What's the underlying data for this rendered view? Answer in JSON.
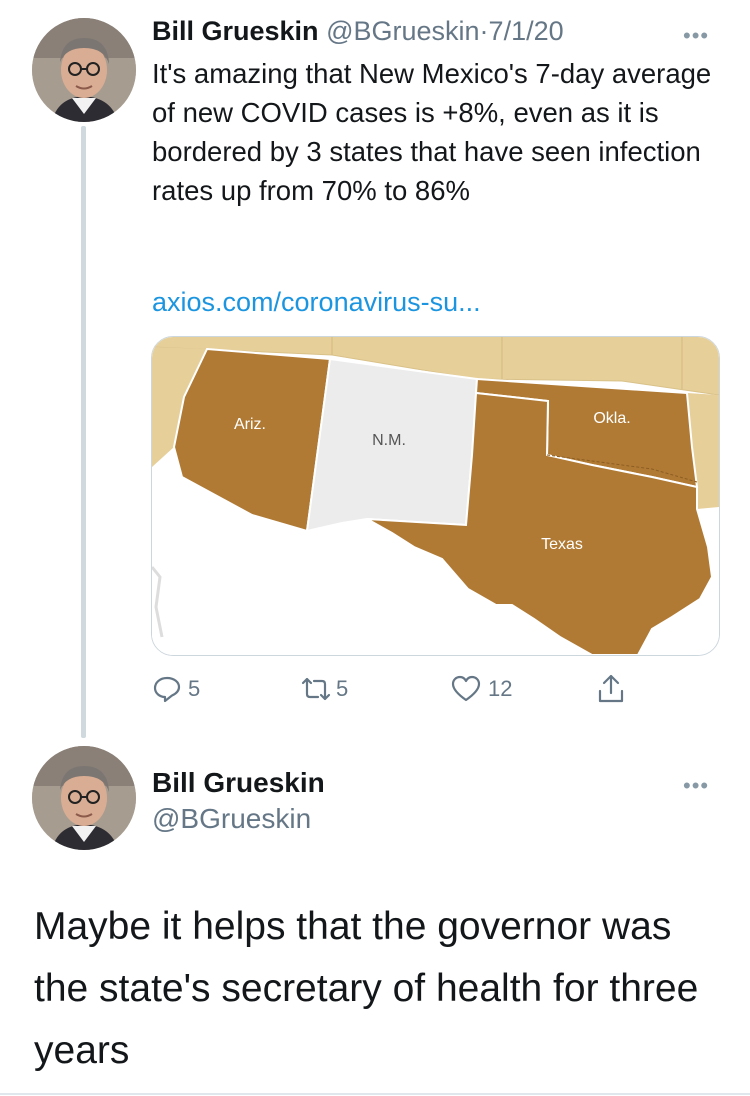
{
  "tweet1": {
    "author_name": "Bill Grueskin",
    "handle": "@BGrueskin",
    "separator": "·",
    "date": "7/1/20",
    "more_label": "•••",
    "text": "It's amazing that New Mexico's 7-day average of new COVID cases is +8%, even as it is bordered by 3 states that have seen infection rates up from 70% to 86%",
    "link_text": "axios.com/coronavirus-su...",
    "map": {
      "labels": {
        "ariz": "Ariz.",
        "nm": "N.M.",
        "okla": "Okla.",
        "texas": "Texas"
      },
      "colors": {
        "highlight": "#b07a34",
        "neutral": "#ececec",
        "background_states": "#e6cf99",
        "water": "#ffffff"
      }
    },
    "actions": {
      "reply_count": "5",
      "retweet_count": "5",
      "like_count": "12"
    }
  },
  "tweet2": {
    "author_name": "Bill Grueskin",
    "handle": "@BGrueskin",
    "more_label": "•••",
    "text": "Maybe it helps that the governor was the state's secretary of health for three years"
  },
  "colors": {
    "link": "#1b95e0",
    "secondary_text": "#657786",
    "thread_line": "#cfd9de"
  }
}
